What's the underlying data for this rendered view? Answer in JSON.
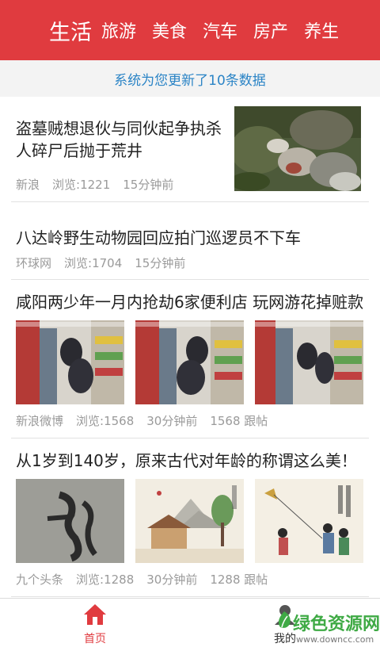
{
  "header": {
    "tabs": [
      "生活",
      "旅游",
      "美食",
      "汽车",
      "房产",
      "养生"
    ],
    "active_index": 0,
    "color": "#e03b3f"
  },
  "notice": {
    "text": "系统为您更新了10条数据",
    "color": "#2b84c6"
  },
  "feed": [
    {
      "title": "盗墓贼想退伙与同伙起争执杀人碎尸后抛于荒井",
      "source": "新浪",
      "views": "浏览:1221",
      "time": "15分钟前"
    },
    {
      "title": "八达岭野生动物园回应拍门巡逻员不下车",
      "source": "环球网",
      "views": "浏览:1704",
      "time": "15分钟前"
    },
    {
      "title": "咸阳两少年一月内抢劫6家便利店 玩网游花掉赃款",
      "source": "新浪微博",
      "views": "浏览:1568",
      "time": "30分钟前",
      "comments": "1568 跟帖"
    },
    {
      "title": "从1岁到140岁，原来古代对年龄的称谓这么美！",
      "source": "九个头条",
      "views": "浏览:1288",
      "time": "30分钟前",
      "comments": "1288 跟帖"
    }
  ],
  "bottom_nav": {
    "home": {
      "label": "首页",
      "icon": "home-icon"
    },
    "mine": {
      "label": "我的",
      "icon": "user-icon"
    }
  },
  "watermark": {
    "text": "绿色资源网",
    "url": "www.downcc.com"
  }
}
